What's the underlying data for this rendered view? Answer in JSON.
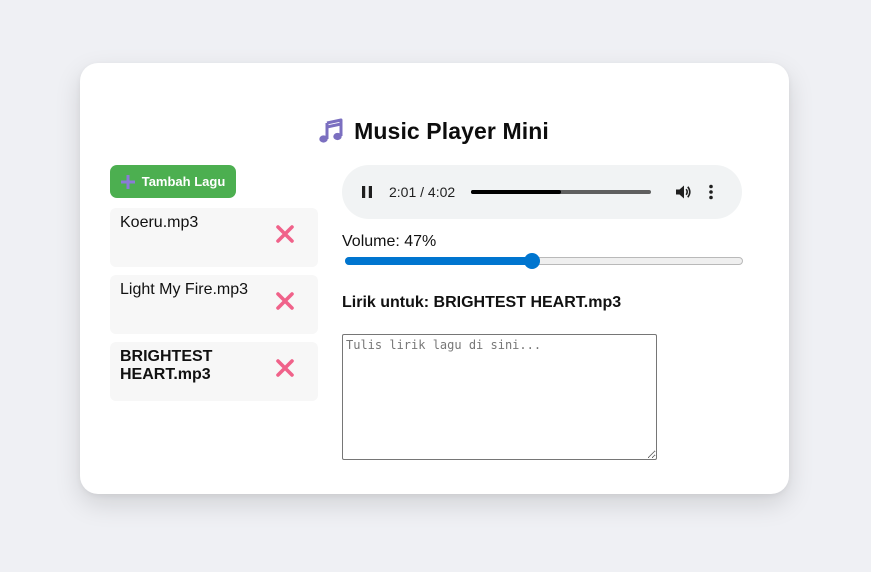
{
  "app": {
    "title": "Music Player Mini",
    "title_icon": "music-note-icon",
    "accent_color": "#4caf50",
    "remove_color": "#f0628a",
    "slider_color": "#0075cf"
  },
  "toolbar": {
    "add_label": "Tambah Lagu",
    "add_icon": "plus-icon"
  },
  "songs": [
    {
      "name": "Koeru.mp3",
      "active": false
    },
    {
      "name": "Light My Fire.mp3",
      "active": false
    },
    {
      "name": "BRIGHTEST HEART.mp3",
      "active": true
    }
  ],
  "player": {
    "state": "playing",
    "time_display": "2:01 / 4:02",
    "progress_fraction": 0.5
  },
  "volume": {
    "label": "Volume: 47%",
    "value": 0.47
  },
  "lyrics": {
    "title": "Lirik untuk: BRIGHTEST HEART.mp3",
    "placeholder": "Tulis lirik lagu di sini...",
    "value": ""
  }
}
